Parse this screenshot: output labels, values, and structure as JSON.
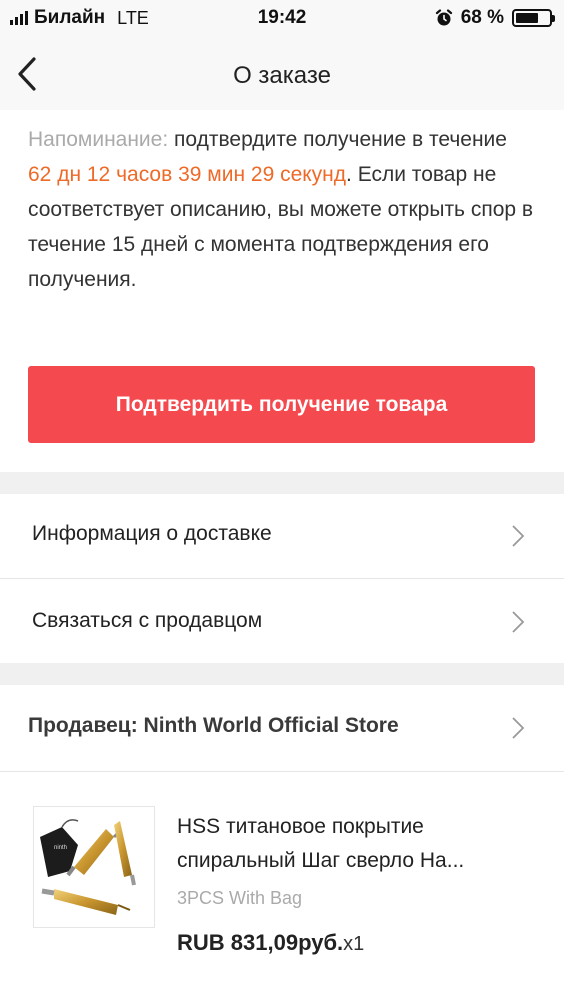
{
  "status_bar": {
    "carrier": "Билайн",
    "network": "LTE",
    "time": "19:42",
    "battery_text": "68 %",
    "battery_level": 0.68,
    "icons": [
      "signal-icon",
      "alarm-icon",
      "battery-icon"
    ]
  },
  "header": {
    "title": "О заказе",
    "back_icon": "chevron-left-icon"
  },
  "reminder": {
    "label": "Напоминание:",
    "text_before": "подтвердите получение в течение",
    "countdown": "62 дн 12 часов 39 мин 29 секунд",
    "text_after": ". Если товар не соответствует описанию, вы можете открыть спор в течение 15 дней с момента подтверждения его получения."
  },
  "confirm_button": {
    "label": "Подтвердить получение товара"
  },
  "menu": {
    "delivery_info": "Информация о доставке",
    "contact_seller": "Связаться с продавцом"
  },
  "seller": {
    "label": "Продавец: Ninth World Official Store"
  },
  "product": {
    "title_line1": "HSS титановое покрытие",
    "title_line2": "спиральный Шаг сверло На...",
    "variant": "3PCS With Bag",
    "price": "RUB 831,09руб.",
    "quantity": "x1"
  },
  "colors": {
    "accent_red": "#f44a4f",
    "countdown_orange": "#ee6a28",
    "muted_gray": "#aaaaaa",
    "section_gap": "#f0f0f0"
  }
}
